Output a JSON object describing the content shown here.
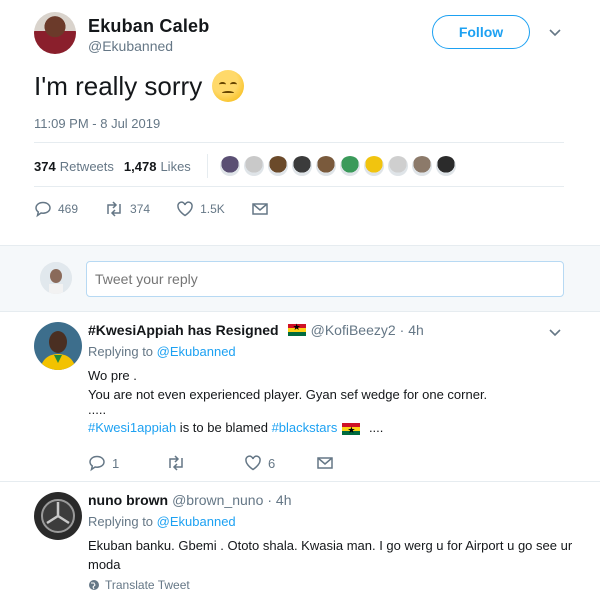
{
  "main_tweet": {
    "author_name": "Ekuban Caleb",
    "author_handle": "@Ekubanned",
    "follow_label": "Follow",
    "text": "I'm really sorry",
    "emoji": "disappointed-face",
    "timestamp": "11:09 PM - 8 Jul 2019",
    "retweets_count": "374",
    "retweets_label": "Retweets",
    "likes_count": "1,478",
    "likes_label": "Likes",
    "liker_colors": [
      "#5a4f73",
      "#c9c9c9",
      "#6b4a2a",
      "#3b3b3b",
      "#7a5a3c",
      "#3a9a5a",
      "#f1c40f",
      "#cfcfcf",
      "#8c7a6a",
      "#2b2b2b"
    ],
    "actions": {
      "replies": "469",
      "retweets": "374",
      "likes": "1.5K"
    }
  },
  "reply_box": {
    "placeholder": "Tweet your reply"
  },
  "replies": [
    {
      "name": "#KwesiAppiah has Resigned",
      "handle": "@KofiBeezy2",
      "time": "· 4h",
      "replying_prefix": "Replying to",
      "replying_to": "@Ekubanned",
      "lines": [
        "Wo pre .",
        "You are not even experienced player. Gyan sef wedge for one corner.",
        "....."
      ],
      "hashtag1": "#Kwesi1appiah",
      "mid_text": " is to be blamed ",
      "hashtag2": "#blackstars",
      "tail": " ....",
      "actions": {
        "replies": "1",
        "retweets": "",
        "likes": "6"
      }
    },
    {
      "name": "nuno brown",
      "handle": "@brown_nuno",
      "time": "· 4h",
      "replying_prefix": "Replying to",
      "replying_to": "@Ekubanned",
      "text": "Ekuban banku. Gbemi . Ototo shala. Kwasia man. I go werg u for Airport u go see ur moda",
      "translate_label": "Translate Tweet"
    }
  ]
}
